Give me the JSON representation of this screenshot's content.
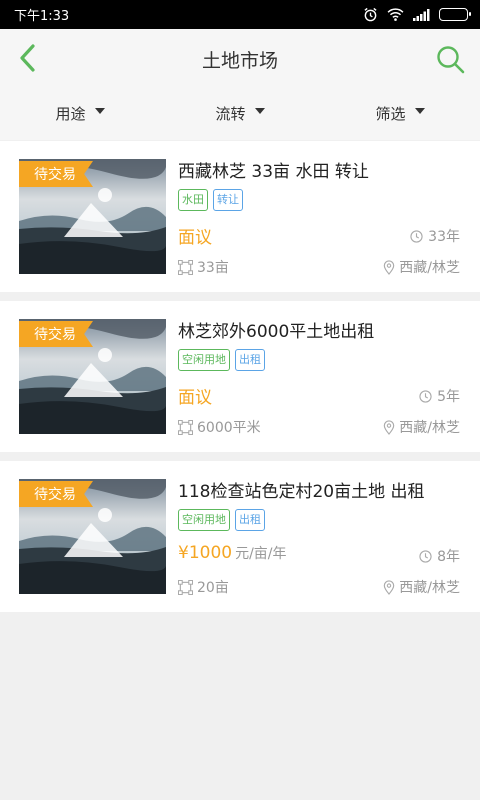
{
  "status_bar": {
    "time": "下午1:33",
    "icons": [
      "alarm-icon",
      "wifi-icon",
      "signal-icon",
      "battery-icon"
    ]
  },
  "header": {
    "title": "土地市场",
    "back_icon": "back-arrow-icon",
    "search_icon": "search-icon",
    "accent_color": "#5cb85c"
  },
  "filters": [
    {
      "label": "用途"
    },
    {
      "label": "流转"
    },
    {
      "label": "筛选"
    }
  ],
  "colors": {
    "badge": "#f5a623",
    "price": "#f5a623",
    "tag_green": "#5cb85c",
    "tag_blue": "#5ba4e6"
  },
  "listings": [
    {
      "badge": "待交易",
      "title": "西藏林芝  33亩 水田 转让",
      "tags": [
        {
          "label": "水田",
          "color": "green"
        },
        {
          "label": "转让",
          "color": "blue"
        }
      ],
      "price": "面议",
      "price_unit": "",
      "term": "33年",
      "area": "33亩",
      "location": "西藏/林芝"
    },
    {
      "badge": "待交易",
      "title": "林芝郊外6000平土地出租",
      "tags": [
        {
          "label": "空闲用地",
          "color": "green"
        },
        {
          "label": "出租",
          "color": "blue"
        }
      ],
      "price": "面议",
      "price_unit": "",
      "term": "5年",
      "area": "6000平米",
      "location": "西藏/林芝"
    },
    {
      "badge": "待交易",
      "title": "118检查站色定村20亩土地 出租",
      "tags": [
        {
          "label": "空闲用地",
          "color": "green"
        },
        {
          "label": "出租",
          "color": "blue"
        }
      ],
      "price": "¥1000",
      "price_unit": "元/亩/年",
      "term": "8年",
      "area": "20亩",
      "location": "西藏/林芝"
    }
  ]
}
